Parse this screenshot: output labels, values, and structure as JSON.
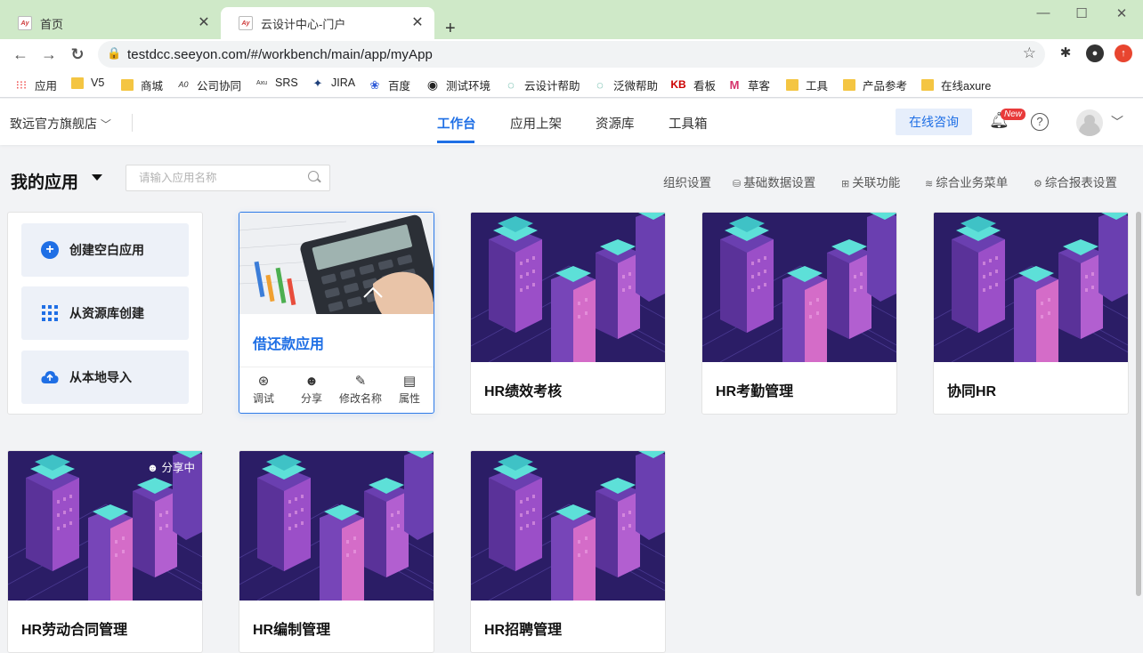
{
  "browser": {
    "tabs": [
      {
        "title": "首页",
        "favicon": "seeyon-favicon"
      },
      {
        "title": "云设计中心-门户",
        "favicon": "seeyon-favicon"
      }
    ],
    "url": "testdcc.seeyon.com/#/workbench/main/app/myApp",
    "bookmarks": [
      {
        "label": "应用",
        "icon": "apps-grid-icon"
      },
      {
        "label": "V5",
        "icon": "folder-icon"
      },
      {
        "label": "商城",
        "icon": "folder-icon"
      },
      {
        "label": "公司协同",
        "icon": "seeyon-icon"
      },
      {
        "label": "SRS",
        "icon": "axure-icon"
      },
      {
        "label": "JIRA",
        "icon": "jira-icon"
      },
      {
        "label": "百度",
        "icon": "baidu-icon"
      },
      {
        "label": "测试环境",
        "icon": "globe-icon"
      },
      {
        "label": "云设计帮助",
        "icon": "help-icon"
      },
      {
        "label": "泛微帮助",
        "icon": "help-icon"
      },
      {
        "label": "看板",
        "icon": "kanban-icon"
      },
      {
        "label": "草客",
        "icon": "m-icon"
      },
      {
        "label": "工具",
        "icon": "folder-icon"
      },
      {
        "label": "产品参考",
        "icon": "folder-icon"
      },
      {
        "label": "在线axure",
        "icon": "folder-icon"
      }
    ]
  },
  "header": {
    "store": "致远官方旗舰店",
    "nav": [
      "工作台",
      "应用上架",
      "资源库",
      "工具箱"
    ],
    "active_nav": "工作台",
    "consult": "在线咨询",
    "new_badge": "New"
  },
  "toolbar": {
    "title": "我的应用",
    "search_placeholder": "请输入应用名称",
    "links": [
      "组织设置",
      "基础数据设置",
      "关联功能",
      "综合业务菜单",
      "综合报表设置"
    ]
  },
  "create": {
    "blank": "创建空白应用",
    "from_library": "从资源库创建",
    "import_local": "从本地导入"
  },
  "selected_app": {
    "name": "借还款应用",
    "actions": [
      "调试",
      "分享",
      "修改名称",
      "属性"
    ]
  },
  "apps": [
    {
      "name": "HR绩效考核",
      "status": ""
    },
    {
      "name": "HR考勤管理",
      "status": ""
    },
    {
      "name": "协同HR",
      "status": ""
    },
    {
      "name": "HR劳动合同管理",
      "status": "分享中"
    },
    {
      "name": "HR编制管理",
      "status": ""
    },
    {
      "name": "HR招聘管理",
      "status": ""
    }
  ],
  "colors": {
    "accent": "#1f6fe5",
    "tabbar": "#cfe9c8",
    "cover_dark": "#2d1e6b",
    "badge_red": "#e83a3a"
  }
}
